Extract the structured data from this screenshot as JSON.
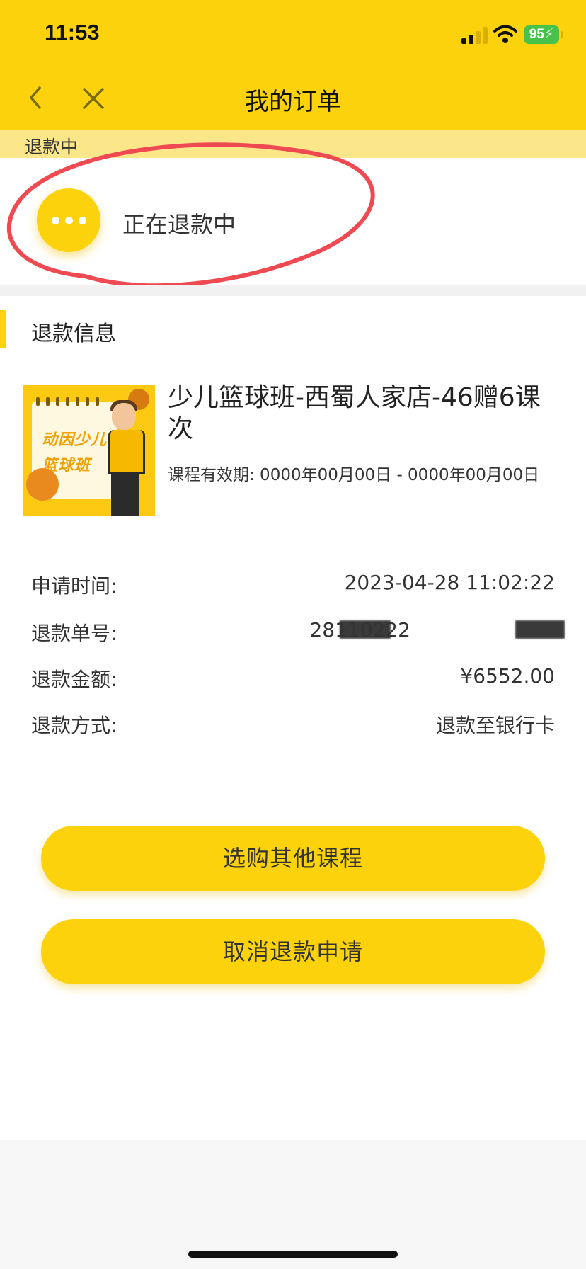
{
  "status_bar": {
    "time": "11:53",
    "battery": "95",
    "signal_icon": "cellular-signal-icon",
    "wifi_icon": "wifi-icon",
    "battery_icon": "battery-charging-icon"
  },
  "nav": {
    "title": "我的订单",
    "back_icon": "chevron-left-icon",
    "close_icon": "close-icon"
  },
  "status_strip": {
    "label": "退款中"
  },
  "status_card": {
    "icon": "ellipsis-icon",
    "text": "正在退款中"
  },
  "refund_section": {
    "title": "退款信息",
    "course": {
      "thumbnail_text_line1": "动因少儿",
      "thumbnail_text_line2": "篮球班",
      "title": "少儿篮球班-西蜀人家店-46赠6课次",
      "validity": "课程有效期: 0000年00月00日 - 0000年00月00日"
    },
    "rows": [
      {
        "label": "申请时间:",
        "value": "2023-04-28 11:02:22"
      },
      {
        "label": "退款单号:",
        "value": "28110222"
      },
      {
        "label": "退款金额:",
        "value": "¥6552.00"
      },
      {
        "label": "退款方式:",
        "value": "退款至银行卡"
      }
    ]
  },
  "buttons": {
    "browse": "选购其他课程",
    "cancel_refund": "取消退款申请"
  },
  "colors": {
    "brand_yellow": "#fcd20c",
    "strip_yellow": "#fbe68a",
    "annotation_red": "#ef4a52"
  }
}
